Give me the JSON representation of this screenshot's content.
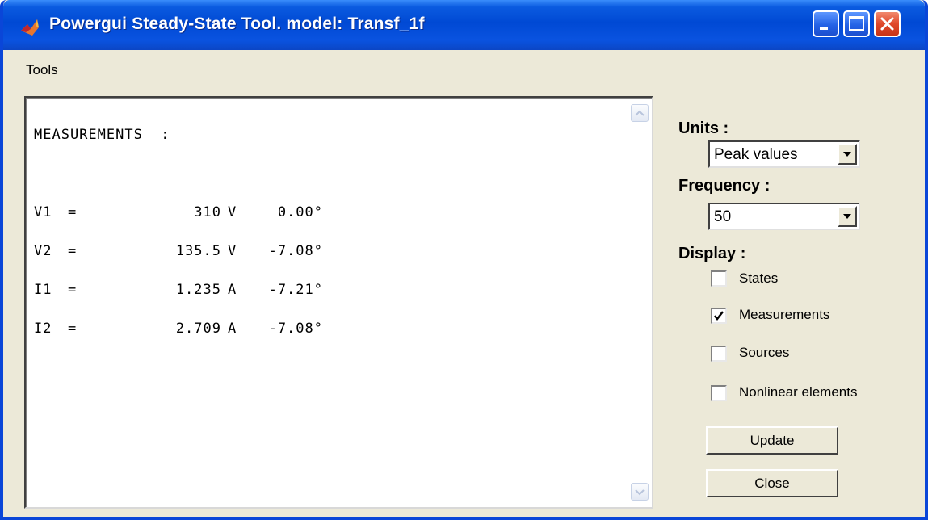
{
  "window": {
    "title": "Powergui Steady-State Tool. model: Transf_1f"
  },
  "menu": {
    "tools": "Tools"
  },
  "output": {
    "header": "MEASUREMENTS  :",
    "rows": [
      {
        "name": "V1",
        "eq": "=",
        "value": "310",
        "unit": "V",
        "angle": "0.00°"
      },
      {
        "name": "V2",
        "eq": "=",
        "value": "135.5",
        "unit": "V",
        "angle": "-7.08°"
      },
      {
        "name": "I1",
        "eq": "=",
        "value": "1.235",
        "unit": "A",
        "angle": "-7.21°"
      },
      {
        "name": "I2",
        "eq": "=",
        "value": "2.709",
        "unit": "A",
        "angle": "-7.08°"
      }
    ]
  },
  "units": {
    "label": "Units :",
    "selected": "Peak values"
  },
  "frequency": {
    "label": "Frequency :",
    "selected": "50"
  },
  "display": {
    "label": "Display :",
    "states": {
      "label": "States",
      "checked": false
    },
    "measurements": {
      "label": "Measurements",
      "checked": true
    },
    "sources": {
      "label": "Sources",
      "checked": false
    },
    "nonlinear": {
      "label": "Nonlinear elements",
      "checked": false
    }
  },
  "buttons": {
    "update": "Update",
    "close": "Close"
  }
}
